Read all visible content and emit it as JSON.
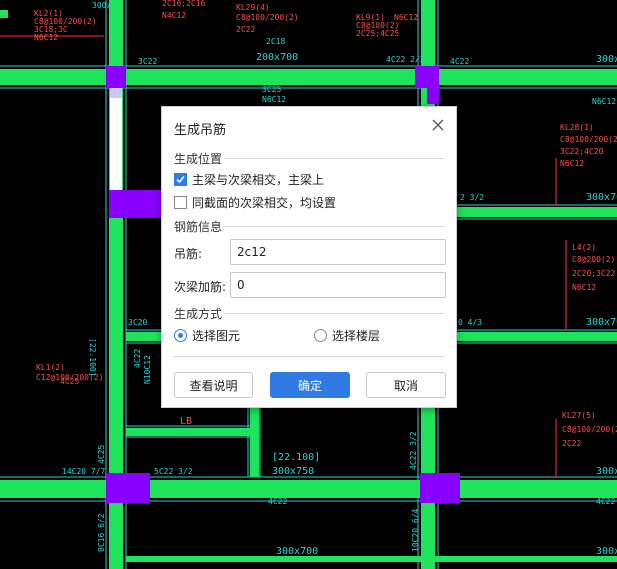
{
  "dialog": {
    "title": "生成吊筋",
    "section_position": "生成位置",
    "opt_main_secondary": "主梁与次梁相交，主梁上",
    "opt_main_secondary_checked": true,
    "opt_same_section": "同截面的次梁相交，均设置",
    "opt_same_section_checked": false,
    "section_rebar": "钢筋信息",
    "hanger_label": "吊筋:",
    "hanger_value": "2c12",
    "extra_label": "次梁加筋:",
    "extra_value": "0",
    "section_method": "生成方式",
    "radio_select_element": "选择图元",
    "radio_select_floor": "选择楼层",
    "selected_method": "选择图元",
    "btn_help": "查看说明",
    "btn_ok": "确定",
    "btn_cancel": "取消"
  },
  "cad_labels": {
    "t1": "KL2(1)",
    "t2": "C8@100/200(2)",
    "t3": "3C18;3C",
    "t4": "N6C12",
    "t5": "2C16;2C16",
    "t6": "N4C12",
    "t7": "KL29(4)",
    "t8": "C8@100/200(2)",
    "t9": "2C22",
    "t10": "2C18",
    "t11": "200x700",
    "t12": "KL9(1)",
    "t13": "C8@100(2)",
    "t14": "2C25;4C25",
    "t15": "N6C12",
    "t16": "4C22 2/2",
    "t17": "4C22",
    "t18": "300x",
    "t19": "3C22",
    "t20": "3C25",
    "t21": "N6C12",
    "t22": "N6C12",
    "t23": "KL28(1)",
    "t24": "C8@100/200(2)",
    "t25": "3C22;4C20",
    "t26": "N6C12",
    "t27": "300x70",
    "t28": "2 3/2",
    "t29": "L4(2)",
    "t30": "C8@200(2)",
    "t31": "2C20;3C22",
    "t32": "N6C12",
    "t33": "3C20",
    "t34": "0 4/3",
    "t35": "300x70",
    "t36": "KL1(2)",
    "t37": "C12@100/200(2)",
    "t38": "4C25",
    "t39": "[22.100]",
    "t40": "4C22",
    "t41": "N10C12",
    "t42": "LB",
    "t43": "[22.100]",
    "t44": "300x750",
    "t45": "KL27(5)",
    "t46": "C8@100/200(2)",
    "t47": "2C22",
    "t48": "14C20 7/7",
    "t49": "5C22 3/2",
    "t50": "4C22",
    "t51": "4C22 3/2",
    "t52": "300x",
    "t53": "4C22",
    "t54": "8C16 6/2",
    "t55": "10C20 6/4",
    "t56": "300x700",
    "t57": "300x",
    "t58": "4C25",
    "t59": "300x"
  }
}
